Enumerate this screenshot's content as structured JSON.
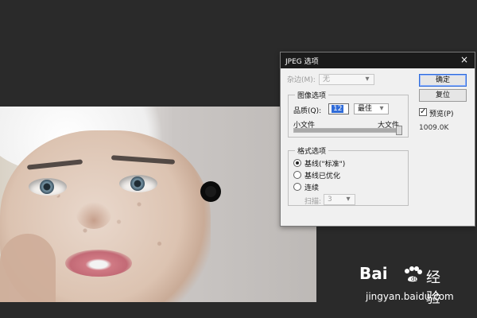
{
  "dialog": {
    "title": "JPEG 选项",
    "matte": {
      "label": "杂边(M):",
      "value": "无"
    },
    "buttons": {
      "ok": "确定",
      "reset": "复位"
    },
    "preview": {
      "label": "预览(P)",
      "checked": true,
      "size": "1009.0K"
    },
    "image_options": {
      "group_label": "图像选项",
      "quality_label": "品质(Q):",
      "quality_value": "12",
      "quality_preset": "最佳",
      "small_file": "小文件",
      "large_file": "大文件",
      "quality_slider_fraction": 1.0
    },
    "format_options": {
      "group_label": "格式选项",
      "options": [
        "基线(\"标准\")",
        "基线已优化",
        "连续"
      ],
      "selected_index": 0,
      "scans_label": "扫描:",
      "scans_value": "3"
    }
  },
  "watermark": {
    "brand_left": "Bai",
    "brand_right": "经验",
    "url": "jingyan.baidu.com"
  },
  "icons": {
    "close": "close-icon",
    "dropdown": "chevron-down-icon",
    "paw": "paw-icon"
  }
}
